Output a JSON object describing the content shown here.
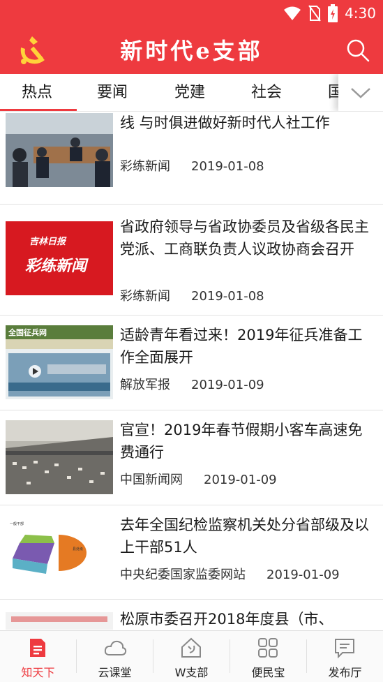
{
  "status_bar": {
    "time": "4:30"
  },
  "header": {
    "title": "新时代e支部",
    "brand_color": "#ee3a3f"
  },
  "tabs": [
    {
      "label": "热点"
    },
    {
      "label": "要闻"
    },
    {
      "label": "党建"
    },
    {
      "label": "社会"
    },
    {
      "label": "国"
    }
  ],
  "articles": [
    {
      "title": "景俊海：降费提标促就业引人才 兜住底线 与时俱进做好新时代人社工作",
      "source": "彩练新闻",
      "date": "2019-01-08"
    },
    {
      "title": "省政府领导与省政协委员及省级各民主党派、工商联负责人议政协商会召开",
      "source": "彩练新闻",
      "date": "2019-01-08",
      "thumb_text": [
        "吉林日报",
        "彩练新闻"
      ]
    },
    {
      "title": "适龄青年看过来！2019年征兵准备工作全面展开",
      "source": "解放军报",
      "date": "2019-01-09",
      "thumb_text": [
        "全国征兵网"
      ]
    },
    {
      "title": "官宣！2019年春节假期小客车高速免费通行",
      "source": "中国新闻网",
      "date": "2019-01-09"
    },
    {
      "title": "去年全国纪检监察机关处分省部级及以上干部51人",
      "source": "中央纪委国家监委网站",
      "date": "2019-01-09"
    },
    {
      "title": "松原市委召开2018年度县（市、"
    }
  ],
  "bottom_nav": [
    {
      "label": "知天下",
      "icon": "document-icon",
      "active": true
    },
    {
      "label": "云课堂",
      "icon": "cloud-icon"
    },
    {
      "label": "W支部",
      "icon": "party-home-icon"
    },
    {
      "label": "便民宝",
      "icon": "grid-icon"
    },
    {
      "label": "发布厅",
      "icon": "message-icon"
    }
  ]
}
